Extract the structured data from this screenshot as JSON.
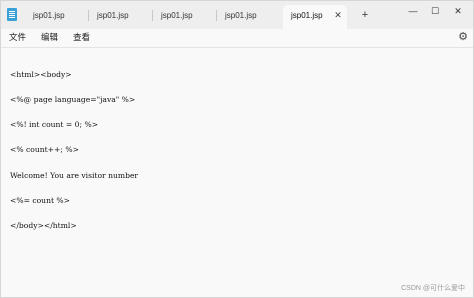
{
  "tabs": [
    {
      "label": "jsp01.jsp",
      "active": false
    },
    {
      "label": "jsp01.jsp",
      "active": false
    },
    {
      "label": "jsp01.jsp",
      "active": false
    },
    {
      "label": "jsp01.jsp",
      "active": false
    },
    {
      "label": "jsp01.jsp",
      "active": true
    }
  ],
  "tab_close": "✕",
  "new_tab": "+",
  "window_controls": {
    "minimize": "—",
    "maximize": "☐",
    "close": "✕"
  },
  "menu": {
    "file": "文件",
    "edit": "编辑",
    "view": "查看"
  },
  "settings_icon": "gear-icon",
  "editor": {
    "lines": [
      "<html><body>",
      "<%@ page language=\"java\" %>",
      "<%! int count = 0; %>",
      "<% count++; %>",
      "Welcome! You are visitor number",
      "<%= count %>",
      "</body></html>"
    ]
  },
  "watermark": "CSDN @可什么爱中",
  "colors": {
    "tabstrip": "#eeeeee",
    "background": "#f9f9f9",
    "app_icon": "#3aa0d8"
  }
}
